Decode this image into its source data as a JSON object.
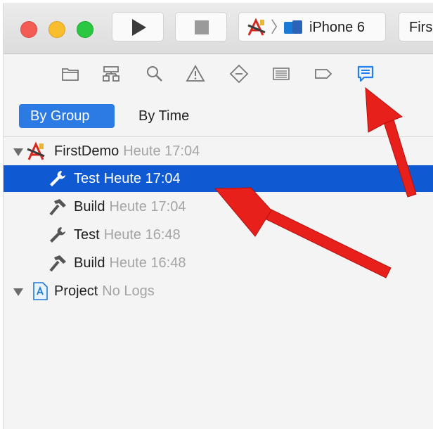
{
  "toolbar": {
    "scheme_device": "iPhone 6",
    "scheme2_label": "Firs"
  },
  "navigator": {
    "icons": [
      "project-navigator-icon",
      "symbol-navigator-icon",
      "find-navigator-icon",
      "issue-navigator-icon",
      "test-navigator-icon",
      "debug-navigator-icon",
      "breakpoint-navigator-icon",
      "report-navigator-icon"
    ],
    "active": "report-navigator-icon"
  },
  "segments": {
    "by_group": "By Group",
    "by_time": "By Time"
  },
  "logs": {
    "root": {
      "name": "FirstDemo",
      "time": "Heute 17:04"
    },
    "items": [
      {
        "name": "Test",
        "time": "Heute 17:04",
        "icon": "wrench-icon"
      },
      {
        "name": "Build",
        "time": "Heute 17:04",
        "icon": "hammer-icon"
      },
      {
        "name": "Test",
        "time": "Heute 16:48",
        "icon": "wrench-icon"
      },
      {
        "name": "Build",
        "time": "Heute 16:48",
        "icon": "hammer-icon"
      }
    ],
    "project": {
      "name": "Project",
      "status": "No Logs"
    }
  },
  "colors": {
    "selection": "#0f5ad2",
    "accent": "#2c7be5",
    "annotation_arrow": "#e8201c"
  }
}
